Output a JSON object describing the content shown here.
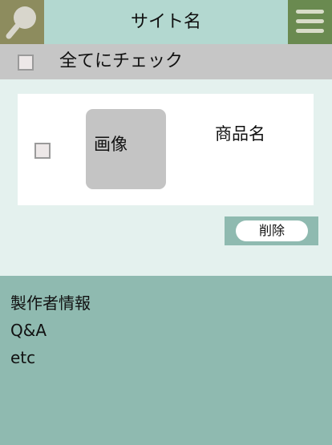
{
  "header": {
    "site_name": "サイト名",
    "search_icon": "magnifier-icon",
    "menu_icon": "hamburger-icon"
  },
  "checkall": {
    "label": "全てにチェック"
  },
  "cart": {
    "items": [
      {
        "image_label": "画像",
        "name": "商品名"
      }
    ],
    "delete_label": "削除"
  },
  "footer": {
    "links": [
      "製作者情報",
      "Q&A",
      "etc"
    ]
  },
  "colors": {
    "header_bg": "#b3d8d0",
    "search_bg": "#8d8c5e",
    "menu_bg": "#6a8a50",
    "checkall_bg": "#c6c6c6",
    "content_bg": "#e4f1ee",
    "footer_bg": "#8fbab0"
  }
}
